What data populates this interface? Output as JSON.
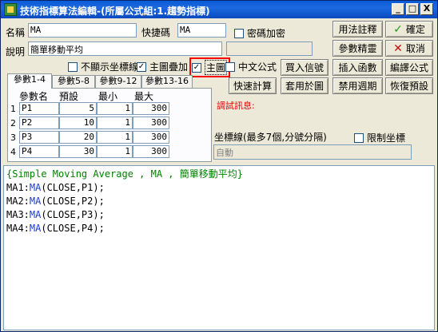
{
  "window": {
    "title": "技術指標算法編輯-(所屬公式組:1.趨勢指標)",
    "buttons": {
      "minimize": "_",
      "maximize": "□",
      "close": "X"
    }
  },
  "form": {
    "name_label": "名稱",
    "name_value": "MA",
    "shortcut_label": "快捷碼",
    "shortcut_value": "MA",
    "password_label": "密碼加密",
    "desc_label": "說明",
    "desc_value": "簡單移動平均",
    "hide_axis_label": "不顯示坐標線",
    "overlay_label": "主圖疊加",
    "main_chart_label": "主圖",
    "chinese_formula_label": "中文公式"
  },
  "right_buttons": {
    "usage": "用法註釋",
    "ok": "確定",
    "param_wizard": "參數精靈",
    "cancel": "取消",
    "buy_sell": "買入信號",
    "insert_func": "插入函數",
    "compile": "編譯公式",
    "quick_calc": "快速計算",
    "apply_chart": "套用於圖",
    "disable_cycle": "禁用週期",
    "restore_default": "恢復預設"
  },
  "tabs": [
    "參數1-4",
    "參數5-8",
    "參數9-12",
    "參數13-16"
  ],
  "params": {
    "headers": [
      "參數名",
      "預設",
      "最小",
      "最大"
    ],
    "rows": [
      {
        "n": "1",
        "name": "P1",
        "default": "5",
        "min": "1",
        "max": "300"
      },
      {
        "n": "2",
        "name": "P2",
        "default": "10",
        "min": "1",
        "max": "300"
      },
      {
        "n": "3",
        "name": "P3",
        "default": "20",
        "min": "1",
        "max": "300"
      },
      {
        "n": "4",
        "name": "P4",
        "default": "30",
        "min": "1",
        "max": "300"
      }
    ]
  },
  "debug_label": "調試訊息:",
  "coord": {
    "label": "坐標線(最多7個,分號分隔)",
    "limit_label": "限制坐標",
    "value": "自動"
  },
  "code": {
    "comment": "{Simple Moving Average , MA , 簡單移動平均}",
    "lines": [
      {
        "pre": "MA1:",
        "fn": "MA",
        "args": "(CLOSE,P1);"
      },
      {
        "pre": "MA2:",
        "fn": "MA",
        "args": "(CLOSE,P2);"
      },
      {
        "pre": "MA3:",
        "fn": "MA",
        "args": "(CLOSE,P3);"
      },
      {
        "pre": "MA4:",
        "fn": "MA",
        "args": "(CLOSE,P4);"
      }
    ]
  },
  "colors": {
    "title_bar": "#0a5bd6",
    "debug_text": "#e00000",
    "comment": "#008000",
    "function": "#1f39d6",
    "highlight_border": "#ff0000"
  }
}
